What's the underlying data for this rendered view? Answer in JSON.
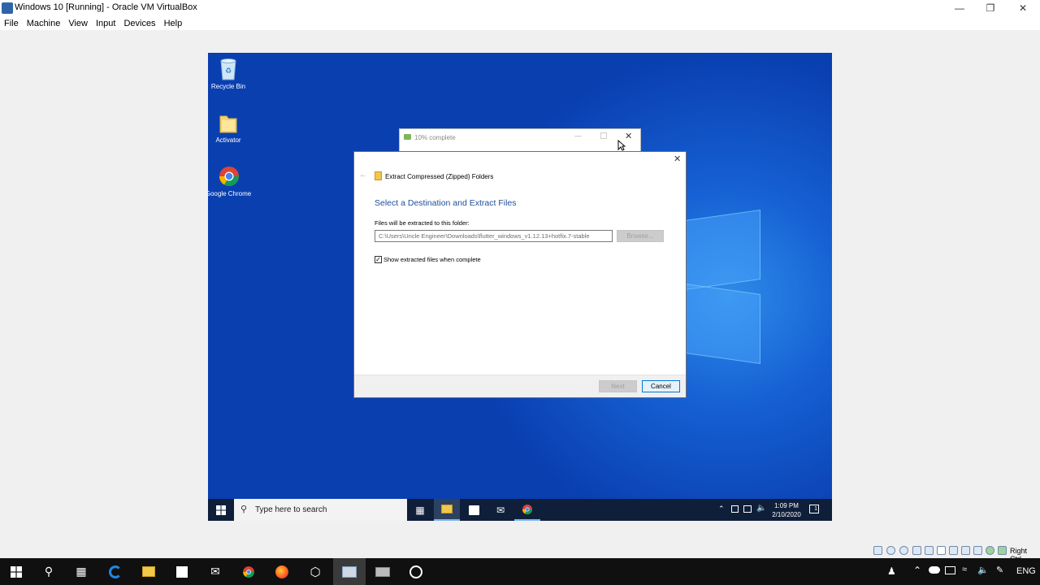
{
  "host": {
    "window_title": "Windows 10 [Running] - Oracle VM VirtualBox",
    "menu": [
      "File",
      "Machine",
      "View",
      "Input",
      "Devices",
      "Help"
    ],
    "status_right_label": "Right Ctrl",
    "tray_language": "ENG"
  },
  "desktop_icons": [
    {
      "label": "Recycle Bin",
      "icon": "recycle-bin-icon"
    },
    {
      "label": "Activator",
      "icon": "folder-icon"
    },
    {
      "label": "Google Chrome",
      "icon": "chrome-icon"
    }
  ],
  "progress_window": {
    "title": "10% complete"
  },
  "dialog": {
    "nav_title": "Extract Compressed (Zipped) Folders",
    "heading": "Select a Destination and Extract Files",
    "path_label": "Files will be extracted to this folder:",
    "path_value": "C:\\Users\\Uncle Engineer\\Downloads\\flutter_windows_v1.12.13+hotfix.7-stable",
    "browse_label": "Browse...",
    "checkbox_label": "Show extracted files when complete",
    "checkbox_checked": true,
    "next_label": "Next",
    "cancel_label": "Cancel"
  },
  "vm_taskbar": {
    "search_placeholder": "Type here to search",
    "clock_time": "1:09 PM",
    "clock_date": "2/10/2020",
    "notification_count": "1"
  },
  "colors": {
    "desktop_blue": "#1560d4",
    "heading_blue": "#1e4e9a",
    "taskbar_dark": "#0f1f3a"
  }
}
